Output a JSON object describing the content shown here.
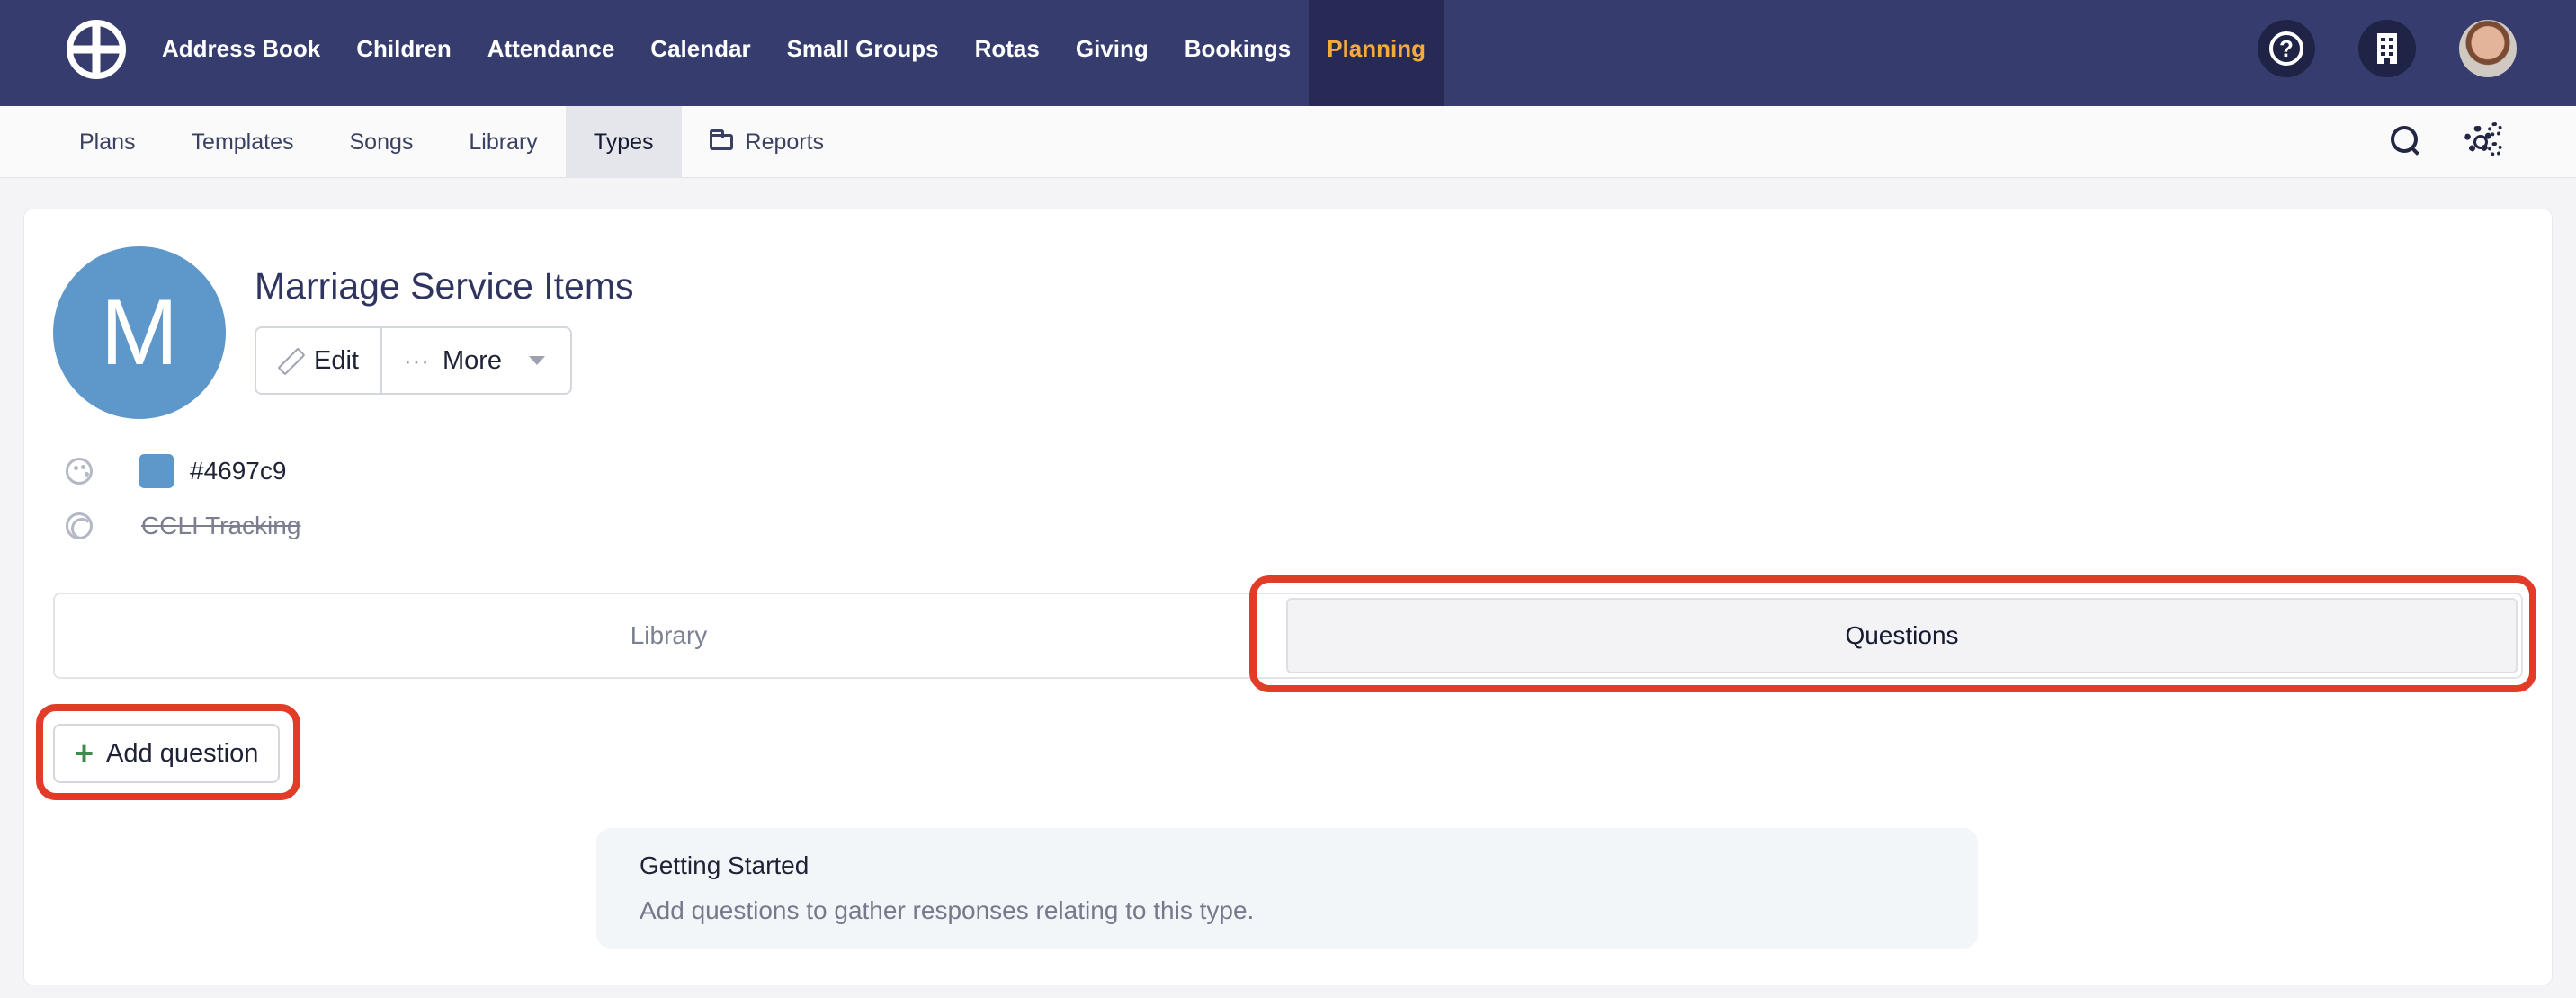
{
  "topnav": {
    "items": [
      {
        "label": "Address Book"
      },
      {
        "label": "Children"
      },
      {
        "label": "Attendance"
      },
      {
        "label": "Calendar"
      },
      {
        "label": "Small Groups"
      },
      {
        "label": "Rotas"
      },
      {
        "label": "Giving"
      },
      {
        "label": "Bookings"
      },
      {
        "label": "Planning",
        "active": true
      }
    ],
    "help_glyph": "?",
    "icons": [
      "help-icon",
      "building-icon",
      "avatar"
    ]
  },
  "subnav": {
    "items": [
      {
        "label": "Plans"
      },
      {
        "label": "Templates"
      },
      {
        "label": "Songs"
      },
      {
        "label": "Library"
      },
      {
        "label": "Types",
        "active": true
      },
      {
        "label": "Reports",
        "icon": "folder-icon"
      }
    ],
    "icons": [
      "search-icon",
      "settings-gears-icon"
    ]
  },
  "header": {
    "avatar_letter": "M",
    "title": "Marriage Service Items",
    "edit_label": "Edit",
    "more_label": "More"
  },
  "meta": {
    "color_value": "#4697c9",
    "ccli_label": "CCLI Tracking"
  },
  "tabs": [
    {
      "label": "Library",
      "active": false
    },
    {
      "label": "Questions",
      "active": true
    }
  ],
  "actions": {
    "add_question_label": "Add question",
    "plus_glyph": "+"
  },
  "getting_started": {
    "title": "Getting Started",
    "text": "Add questions to gather responses relating to this type."
  },
  "colors": {
    "nav_bg": "#363c6e",
    "nav_active_text": "#f2ab3c",
    "type_color": "#5e97c9",
    "highlight": "#e23c28",
    "add_icon": "#3d8c4b"
  }
}
